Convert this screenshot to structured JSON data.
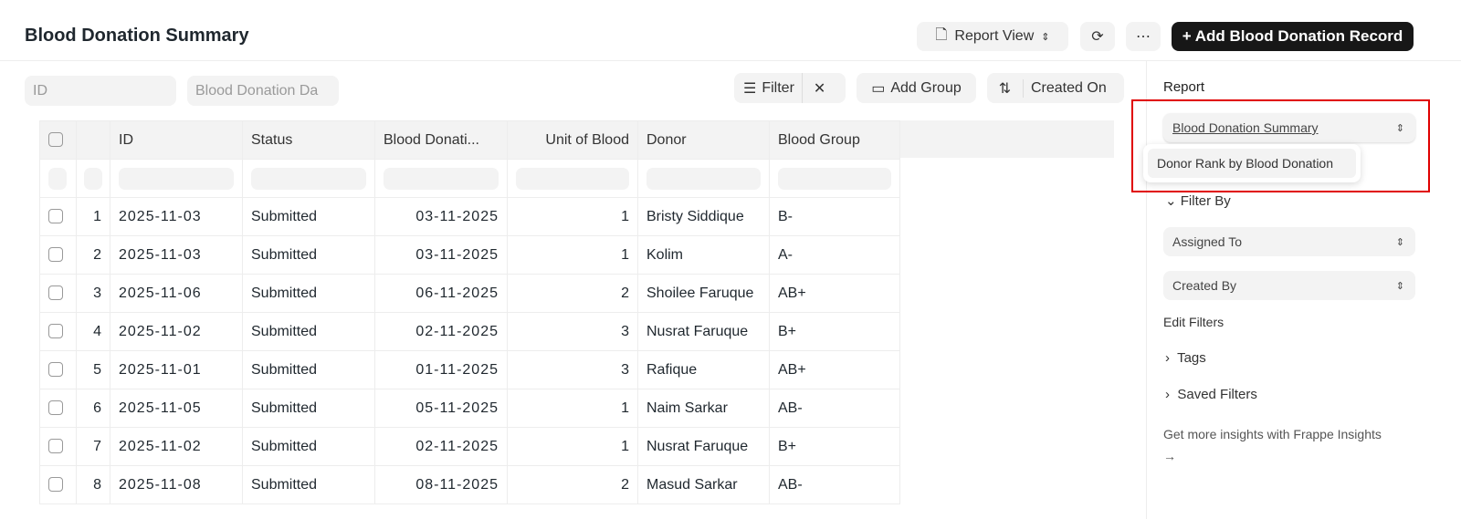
{
  "header": {
    "title": "Blood Donation Summary",
    "view_label": "Report View",
    "add_label": "+ Add Blood Donation Record"
  },
  "filters": {
    "id_placeholder": "ID",
    "date_placeholder": "Blood Donation Da",
    "filter_label": "Filter",
    "add_group_label": "Add Group",
    "sort_label": "Created On"
  },
  "table": {
    "columns": [
      "ID",
      "Status",
      "Blood Donati...",
      "Unit of Blood",
      "Donor",
      "Blood Group"
    ],
    "rows": [
      {
        "n": "1",
        "id": "2025-11-03",
        "status": "Submitted",
        "date": "03-11-2025",
        "units": "1",
        "donor": "Bristy Siddique",
        "group": "B-"
      },
      {
        "n": "2",
        "id": "2025-11-03",
        "status": "Submitted",
        "date": "03-11-2025",
        "units": "1",
        "donor": "Kolim",
        "group": "A-"
      },
      {
        "n": "3",
        "id": "2025-11-06",
        "status": "Submitted",
        "date": "06-11-2025",
        "units": "2",
        "donor": "Shoilee Faruque",
        "group": "AB+"
      },
      {
        "n": "4",
        "id": "2025-11-02",
        "status": "Submitted",
        "date": "02-11-2025",
        "units": "3",
        "donor": "Nusrat Faruque",
        "group": "B+"
      },
      {
        "n": "5",
        "id": "2025-11-01",
        "status": "Submitted",
        "date": "01-11-2025",
        "units": "3",
        "donor": "Rafique",
        "group": "AB+"
      },
      {
        "n": "6",
        "id": "2025-11-05",
        "status": "Submitted",
        "date": "05-11-2025",
        "units": "1",
        "donor": "Naim Sarkar",
        "group": "AB-"
      },
      {
        "n": "7",
        "id": "2025-11-02",
        "status": "Submitted",
        "date": "02-11-2025",
        "units": "1",
        "donor": "Nusrat Faruque",
        "group": "B+"
      },
      {
        "n": "8",
        "id": "2025-11-08",
        "status": "Submitted",
        "date": "08-11-2025",
        "units": "2",
        "donor": "Masud Sarkar",
        "group": "AB-"
      }
    ]
  },
  "sidebar": {
    "report_label": "Report",
    "report_value": "Blood Donation Summary",
    "dropdown_option": "Donor Rank by Blood Donation",
    "filter_by": "Filter By",
    "assigned_to": "Assigned To",
    "created_by": "Created By",
    "edit_filters": "Edit Filters",
    "tags": "Tags",
    "saved_filters": "Saved Filters",
    "insights": "Get more insights with Frappe Insights",
    "arrow": "→"
  },
  "colors": {
    "highlight": "#e00000",
    "primary": "#171717"
  }
}
